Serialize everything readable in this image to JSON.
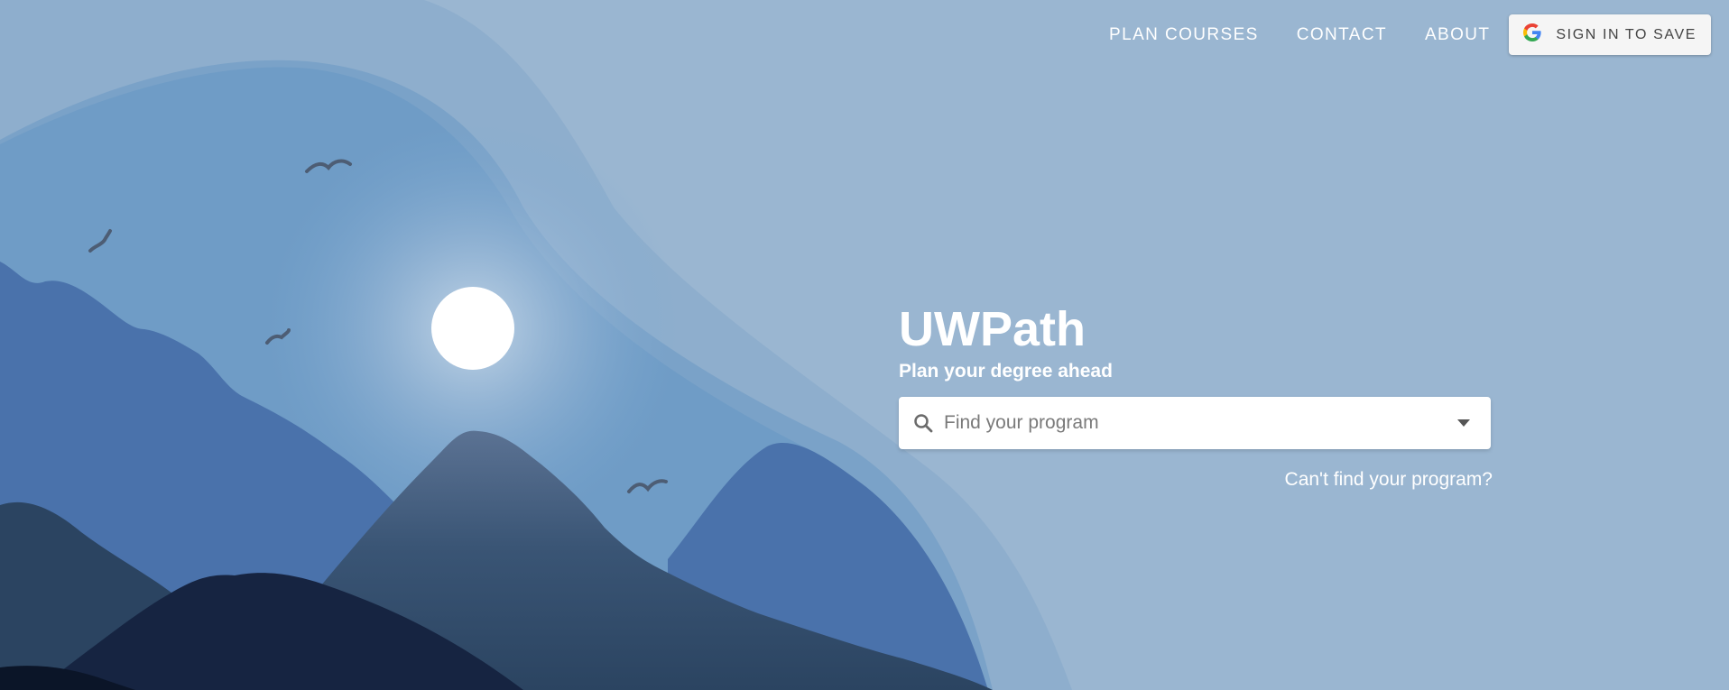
{
  "nav": {
    "plan_courses": "PLAN COURSES",
    "contact": "CONTACT",
    "about": "ABOUT",
    "sign_in": "SIGN IN TO SAVE",
    "sign_in_icon": "google-icon"
  },
  "hero": {
    "title": "UWPath",
    "subtitle": "Plan your degree ahead",
    "search_placeholder": "Find your program",
    "search_icon": "search-icon",
    "dropdown_icon": "caret-down-icon",
    "cant_find": "Can't find your program?"
  },
  "colors": {
    "background": "#9ab6d1",
    "accent_white": "#ffffff",
    "mountain_dark": "#2d4863",
    "mountain_deep": "#162441"
  }
}
